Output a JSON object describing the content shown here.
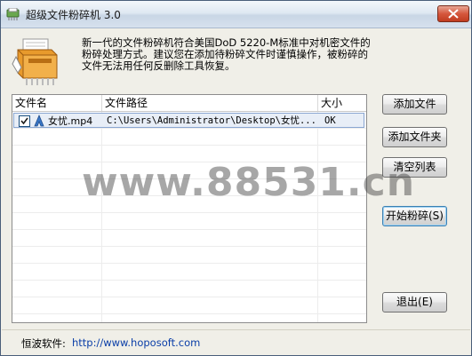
{
  "window": {
    "title": "超级文件粉碎机  3.0"
  },
  "description": "新一代的文件粉碎机符合美国DoD 5220-M标准中对机密文件的粉碎处理方式。建议您在添加待粉碎文件时谨慎操作，被粉碎的文件无法用任何反删除工具恢复。",
  "file_list": {
    "columns": [
      "文件名",
      "文件路径",
      "大小"
    ],
    "rows": [
      {
        "checked": true,
        "name": "女忧.mp4",
        "path": "C:\\Users\\Administrator\\Desktop\\女忧...",
        "size": "OK"
      }
    ]
  },
  "buttons": {
    "add_file": "添加文件",
    "add_folder": "添加文件夹",
    "clear_list": "清空列表",
    "start_shred": "开始粉碎(S)",
    "exit": "退出(E)"
  },
  "watermark": "www.88531.cn",
  "footer": {
    "label": "恒波软件:",
    "link": "http://www.hoposoft.com"
  },
  "colors": {
    "link": "#0a3ea8",
    "selection": "#e8eef7",
    "close_button": "#c03c20"
  },
  "icons": {
    "app": "shredder-icon",
    "close": "close-icon",
    "checkbox": "checkmark-icon",
    "file": "video-file-icon"
  }
}
